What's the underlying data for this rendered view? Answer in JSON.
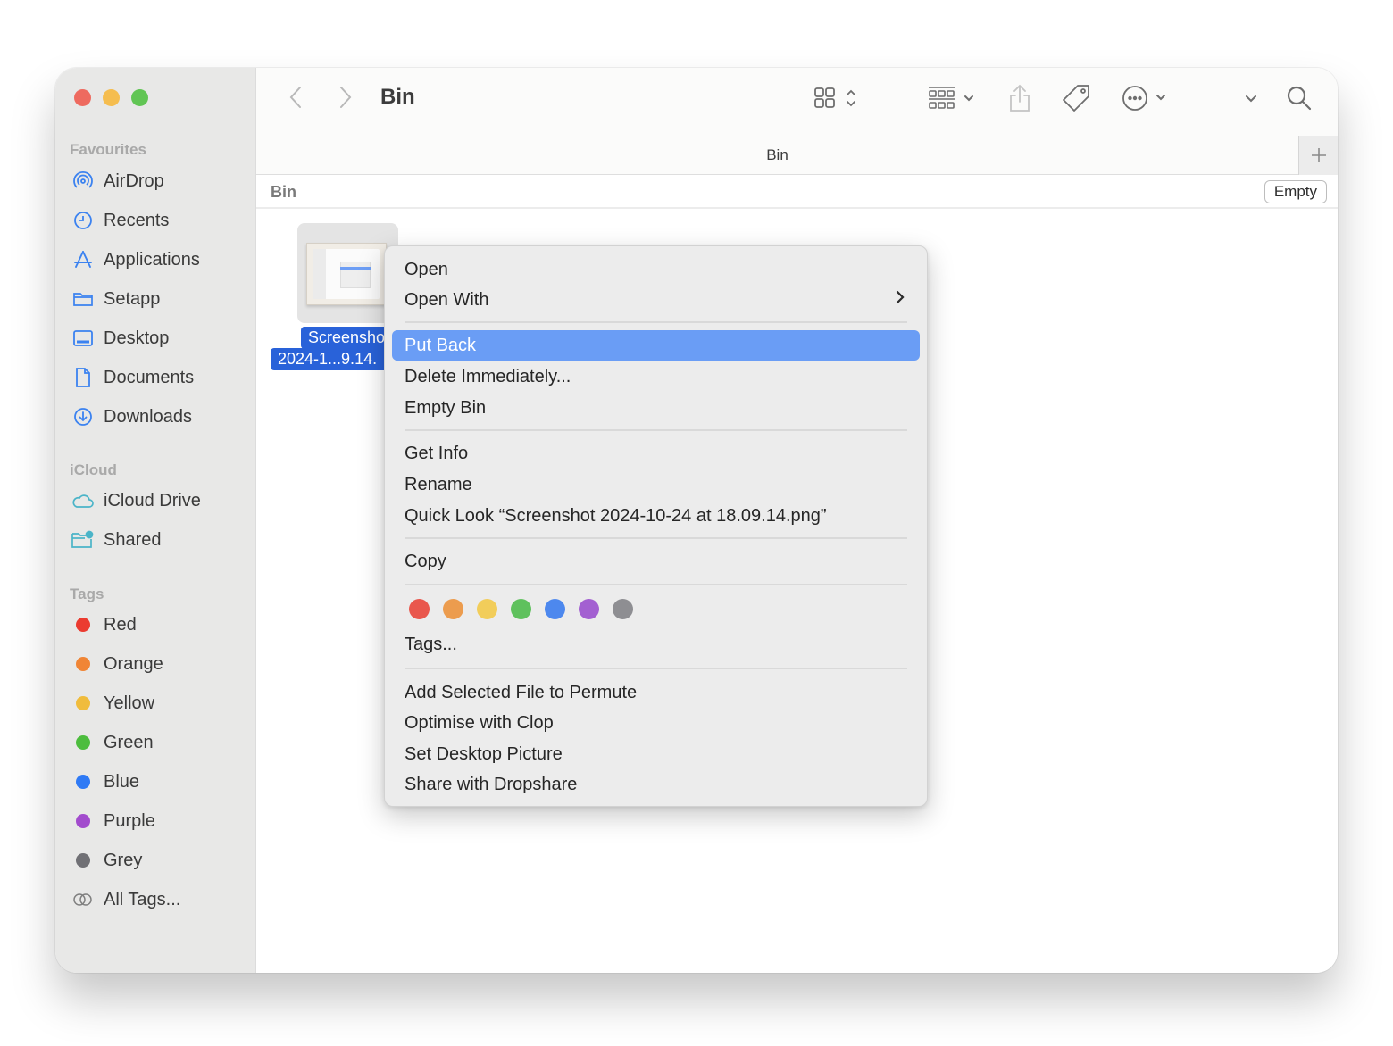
{
  "window": {
    "title": "Bin",
    "tab_label": "Bin",
    "path_label": "Bin",
    "empty_button": "Empty"
  },
  "sidebar": {
    "favourites_header": "Favourites",
    "favourites": [
      {
        "label": "AirDrop",
        "icon": "airdrop-icon"
      },
      {
        "label": "Recents",
        "icon": "clock-icon"
      },
      {
        "label": "Applications",
        "icon": "applications-icon"
      },
      {
        "label": "Setapp",
        "icon": "folder-icon"
      },
      {
        "label": "Desktop",
        "icon": "desktop-icon"
      },
      {
        "label": "Documents",
        "icon": "document-icon"
      },
      {
        "label": "Downloads",
        "icon": "download-icon"
      }
    ],
    "icloud_header": "iCloud",
    "icloud": [
      {
        "label": "iCloud Drive",
        "icon": "cloud-icon"
      },
      {
        "label": "Shared",
        "icon": "shared-folder-icon"
      }
    ],
    "tags_header": "Tags",
    "tags": [
      {
        "label": "Red",
        "color": "#eb3b30"
      },
      {
        "label": "Orange",
        "color": "#f08535"
      },
      {
        "label": "Yellow",
        "color": "#f0bc3c"
      },
      {
        "label": "Green",
        "color": "#4dbd3e"
      },
      {
        "label": "Blue",
        "color": "#2f7af5"
      },
      {
        "label": "Purple",
        "color": "#a24bcd"
      },
      {
        "label": "Grey",
        "color": "#707075"
      }
    ],
    "all_tags": "All Tags..."
  },
  "file": {
    "name_line1": "Screensho",
    "name_line2": "2024-1...9.14."
  },
  "context_menu": {
    "items": [
      {
        "label": "Open"
      },
      {
        "label": "Open With",
        "submenu": true
      },
      {
        "label": "Put Back",
        "highlighted": true
      },
      {
        "label": "Delete Immediately..."
      },
      {
        "label": "Empty Bin"
      },
      {
        "label": "Get Info"
      },
      {
        "label": "Rename"
      },
      {
        "label": "Quick Look “Screenshot 2024-10-24 at 18.09.14.png”"
      },
      {
        "label": "Copy"
      },
      {
        "label": "Tags..."
      },
      {
        "label": "Add Selected File to Permute"
      },
      {
        "label": "Optimise with Clop"
      },
      {
        "label": "Set Desktop Picture"
      },
      {
        "label": "Share with Dropshare"
      }
    ],
    "tag_colors": [
      "#e9574d",
      "#ec9c4e",
      "#f2cd5a",
      "#5fc15d",
      "#4d88ee",
      "#a360d1",
      "#8e8e92"
    ],
    "highlight_color": "#6a9df5"
  },
  "accent_color": "#2962d9"
}
